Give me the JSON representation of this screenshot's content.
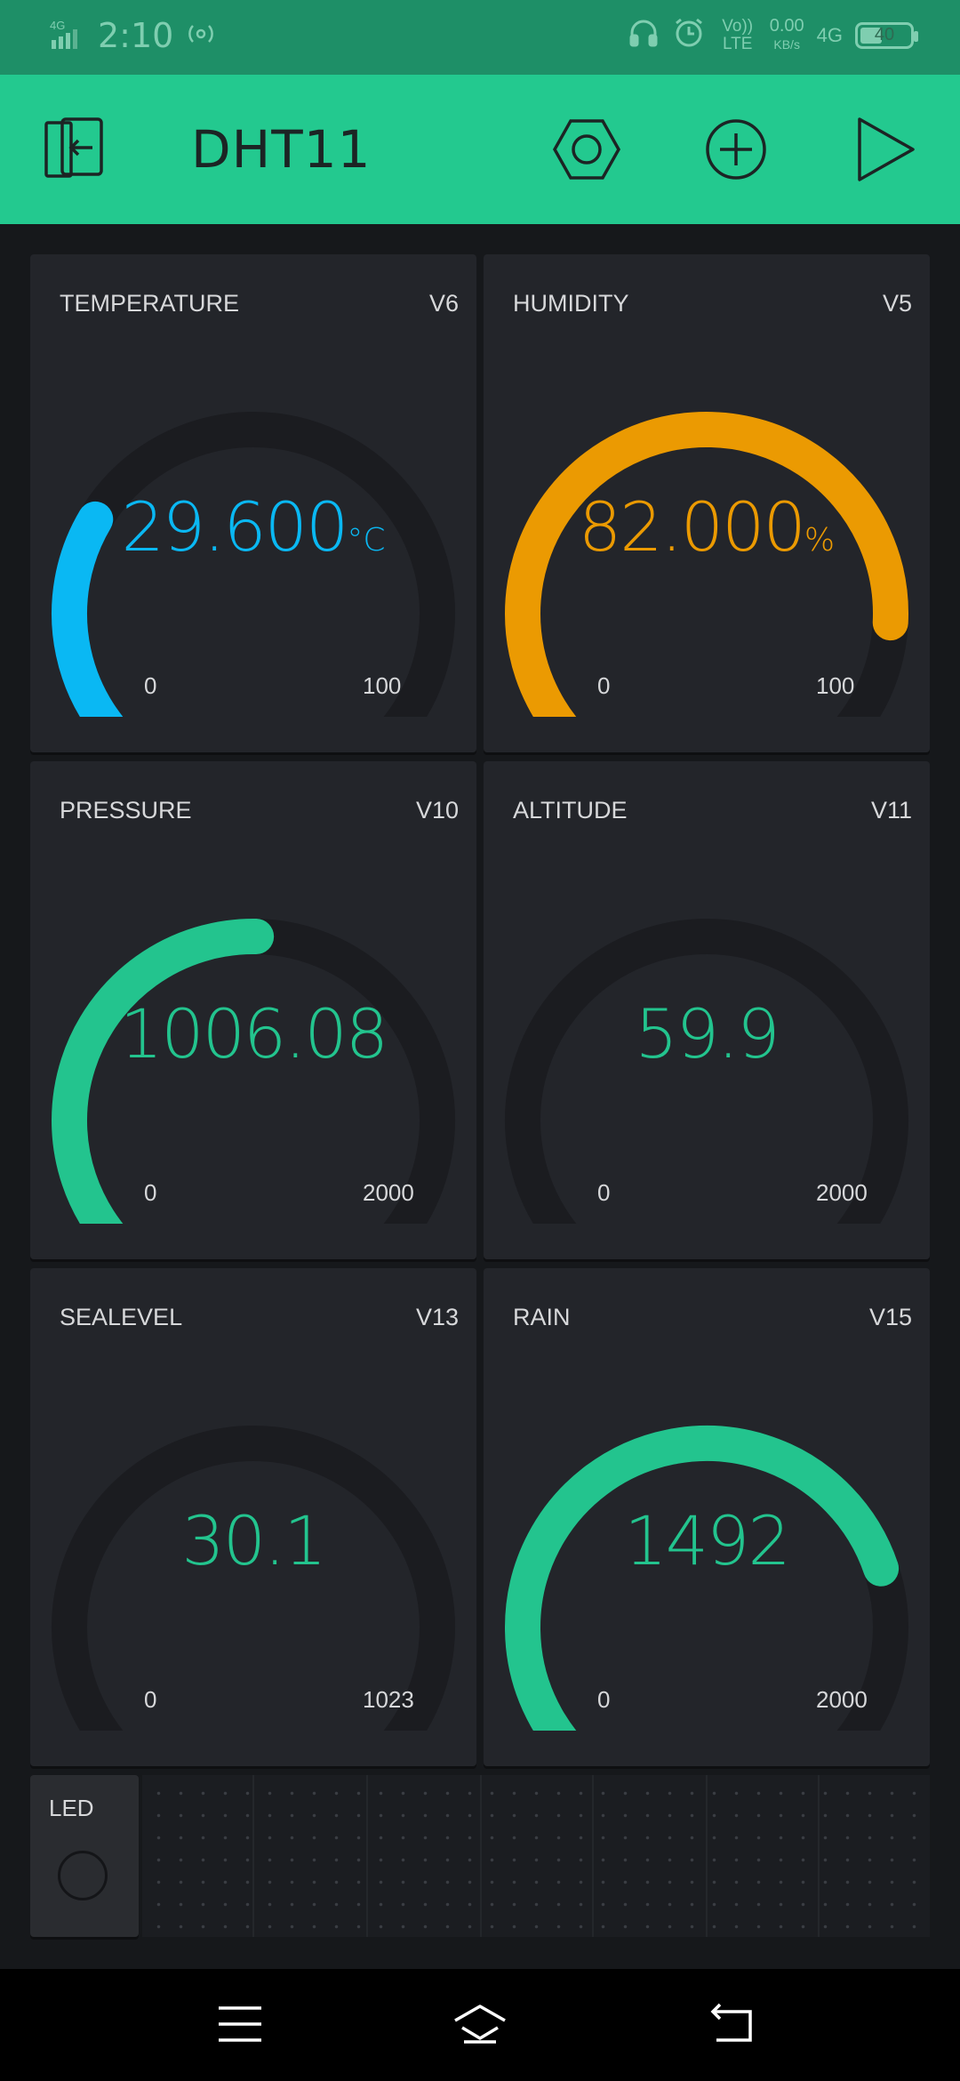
{
  "status_bar": {
    "network": "4G",
    "time": "2:10",
    "volte": "Vo)) LTE",
    "speed_value": "0.00",
    "speed_unit": "KB/s",
    "network_right": "4G",
    "battery": "40"
  },
  "app_bar": {
    "title": "DHT11",
    "icons": [
      "exit-icon",
      "settings-hexagon-icon",
      "add-circle-icon",
      "play-icon"
    ]
  },
  "colors": {
    "app_bar": "#23c98f",
    "status_bar": "#1e8f67",
    "temperature": "#0ab8f3",
    "humidity": "#eb9a02",
    "green": "#23c48e",
    "track": "#1b1c20",
    "card": "#23252a"
  },
  "gauges": [
    {
      "label": "TEMPERATURE",
      "pin": "V6",
      "value": "29.600",
      "unit": "°C",
      "min": "0",
      "max": "100",
      "fraction": 0.296,
      "color": "#0ab8f3"
    },
    {
      "label": "HUMIDITY",
      "pin": "V5",
      "value": "82.000",
      "unit": "%",
      "min": "0",
      "max": "100",
      "fraction": 0.82,
      "color": "#eb9a02"
    },
    {
      "label": "PRESSURE",
      "pin": "V10",
      "value": "1006.08",
      "unit": "",
      "min": "0",
      "max": "2000",
      "fraction": 0.503,
      "color": "#23c48e"
    },
    {
      "label": "ALTITUDE",
      "pin": "V11",
      "value": "59.9",
      "unit": "",
      "min": "0",
      "max": "2000",
      "fraction": 0.03,
      "color": "#23c48e"
    },
    {
      "label": "SEALEVEL",
      "pin": "V13",
      "value": "30.1",
      "unit": "",
      "min": "0",
      "max": "1023",
      "fraction": 0.029,
      "color": "#23c48e"
    },
    {
      "label": "RAIN",
      "pin": "V15",
      "value": "1492",
      "unit": "",
      "min": "0",
      "max": "2000",
      "fraction": 0.746,
      "color": "#23c48e"
    }
  ],
  "led": {
    "label": "LED"
  },
  "nav_bar": {
    "icons": [
      "menu-icon",
      "home-icon",
      "back-icon"
    ]
  }
}
